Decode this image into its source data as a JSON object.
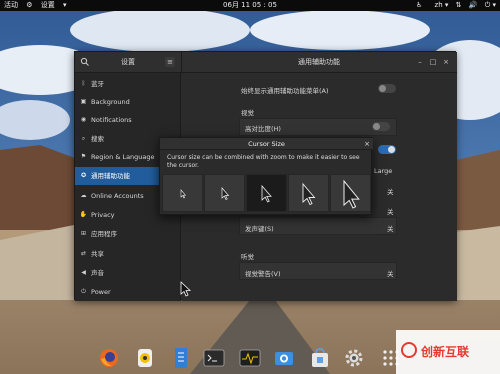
{
  "topbar": {
    "activities": "活动",
    "app_menu": "设置",
    "clock": "06月 11 05 : 05",
    "lang": "zh"
  },
  "settings": {
    "sidebar_title": "设置",
    "panel_title": "通用辅助功能",
    "sidebar_items": [
      {
        "label": "蓝牙",
        "icon": "bluetooth-icon"
      },
      {
        "label": "Background",
        "icon": "image-icon"
      },
      {
        "label": "Notifications",
        "icon": "bell-icon"
      },
      {
        "label": "搜索",
        "icon": "search-icon"
      },
      {
        "label": "Region & Language",
        "icon": "flag-icon"
      },
      {
        "label": "通用辅助功能",
        "icon": "accessibility-icon"
      },
      {
        "label": "Online Accounts",
        "icon": "cloud-icon"
      },
      {
        "label": "Privacy",
        "icon": "hand-icon"
      },
      {
        "label": "应用程序",
        "icon": "apps-icon"
      },
      {
        "label": "共享",
        "icon": "share-icon"
      },
      {
        "label": "声音",
        "icon": "speaker-icon"
      },
      {
        "label": "Power",
        "icon": "power-icon"
      }
    ],
    "main": {
      "always_show_menu": "始终显示通用辅助功能菜单(A)",
      "section_vision": "视觉",
      "high_contrast": "高对比度(H)",
      "large_text": "Large",
      "off_value": "关",
      "sound_keys": "发声键(S)",
      "section_hearing": "听觉",
      "visual_alerts": "视觉警告(V)"
    }
  },
  "dialog": {
    "title": "Cursor Size",
    "description": "Cursor size can be combined with zoom to make it easier to see the cursor.",
    "options_count": 5,
    "selected_index": 2
  },
  "watermark": {
    "text": "创新互联"
  },
  "colors": {
    "accent": "#215d9c",
    "panel": "#2b2b2b",
    "topbar": "#0b0b0b"
  }
}
